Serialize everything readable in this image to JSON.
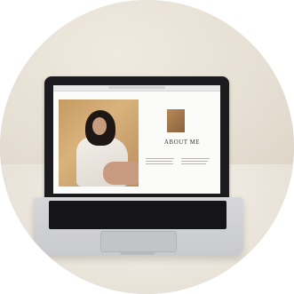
{
  "photo": {
    "subject": "laptop-on-table",
    "website": {
      "heading": "ABOUT ME"
    }
  }
}
